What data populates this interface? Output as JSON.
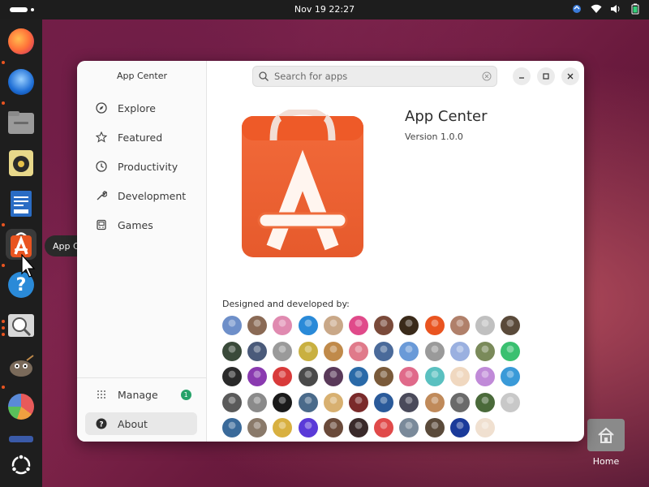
{
  "topbar": {
    "clock": "Nov 19  22:27"
  },
  "dock": {
    "tooltip": "App Center",
    "items": [
      {
        "name": "firefox",
        "color": "#ff7139"
      },
      {
        "name": "thunderbird",
        "color": "#1f6fd6"
      },
      {
        "name": "files",
        "color": "#9a9a9a"
      },
      {
        "name": "rhythmbox",
        "color": "#e6c14a"
      },
      {
        "name": "libreoffice-writer",
        "color": "#2a6cc4"
      },
      {
        "name": "app-center",
        "color": "#e95420"
      },
      {
        "name": "help",
        "color": "#2a8ad8"
      },
      {
        "name": "image-viewer",
        "color": "#cfcfcf"
      },
      {
        "name": "gimp",
        "color": "#7a6a5a"
      },
      {
        "name": "disk-usage",
        "color": "#e85a5a"
      }
    ]
  },
  "desktop": {
    "home_label": "Home"
  },
  "window": {
    "sidebar_title": "App Center",
    "search": {
      "placeholder": "Search for apps"
    },
    "nav": [
      {
        "label": "Explore",
        "icon": "compass-icon"
      },
      {
        "label": "Featured",
        "icon": "star-icon"
      },
      {
        "label": "Productivity",
        "icon": "clock-icon"
      },
      {
        "label": "Development",
        "icon": "wrench-icon"
      },
      {
        "label": "Games",
        "icon": "gamepad-icon"
      }
    ],
    "manage": {
      "label": "Manage",
      "badge": "1"
    },
    "about": {
      "label": "About"
    },
    "app": {
      "name": "App Center",
      "version": "Version 1.0.0"
    },
    "credits_title": "Designed and developed by:",
    "avatar_colors": [
      "#6e8fc9",
      "#8a6a55",
      "#e08ab0",
      "#2a8ad8",
      "#c9a888",
      "#e04a8a",
      "#7a4a3a",
      "#3a2a1a",
      "#e95420",
      "#b0806a",
      "#c0c0c0",
      "#5a4a3a",
      "#3a4a3a",
      "#4a5a7a",
      "#9a9a9a",
      "#c9b040",
      "#c08a4a",
      "#e07a8a",
      "#4a6a9a",
      "#6a9ad8",
      "#9a9a9a",
      "#9ab0e0",
      "#7a8a5a",
      "#3ac070",
      "#2a2a2a",
      "#8a3ab0",
      "#d83a3a",
      "#4a4a4a",
      "#5a3a5a",
      "#2a6aa8",
      "#7a5a3a",
      "#e06a8a",
      "#5ac0c0",
      "#f0d8c0",
      "#c08ad8",
      "#3a9ad8",
      "#5a5a5a",
      "#8a8a8a",
      "#1a1a1a",
      "#4a6a8a",
      "#d8b070",
      "#7a2a2a",
      "#2a5a9a",
      "#4a4a5a",
      "#c08a5a",
      "#6a6a6a",
      "#4a6a3a",
      "#c8c8c8",
      "#3a6a9a",
      "#8a7a6a",
      "#d8b040",
      "#5a3ad8",
      "#6a4a3a",
      "#3a2a2a",
      "#e04a4a",
      "#7a8a9a",
      "#5a4a3a",
      "#1a3a9a",
      "#f0e0d0"
    ]
  }
}
